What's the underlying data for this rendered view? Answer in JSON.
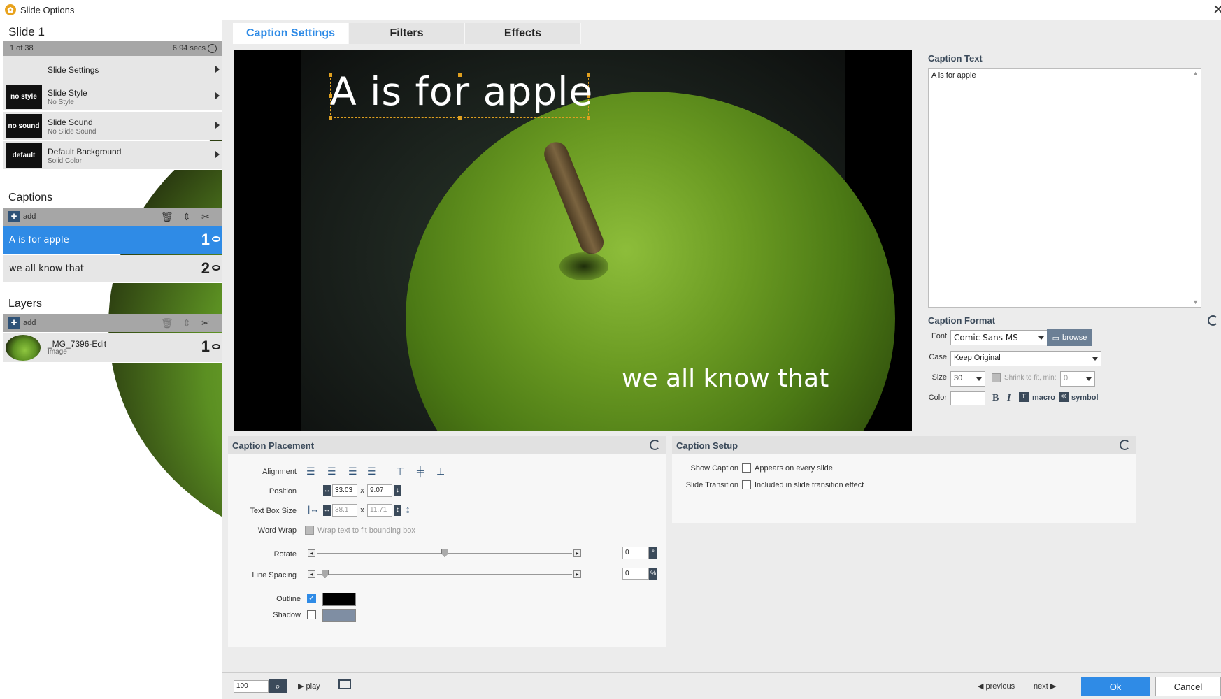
{
  "window": {
    "title": "Slide Options"
  },
  "slide": {
    "name": "Slide 1",
    "position": "1 of 38",
    "duration": "6.94 secs"
  },
  "slide_menu": [
    {
      "title": "Slide Settings",
      "subtitle": "",
      "thumb": ""
    },
    {
      "title": "Slide Style",
      "subtitle": "No Style",
      "thumb": "no style"
    },
    {
      "title": "Slide Sound",
      "subtitle": "No Slide Sound",
      "thumb": "no sound"
    },
    {
      "title": "Default Background",
      "subtitle": "Solid Color",
      "thumb": "default"
    }
  ],
  "captions": {
    "heading": "Captions",
    "add_label": "add",
    "items": [
      {
        "text": "A is for apple",
        "num": "1"
      },
      {
        "text": "we all know that",
        "num": "2"
      }
    ]
  },
  "layers": {
    "heading": "Layers",
    "add_label": "add",
    "items": [
      {
        "name": "_MG_7396-Edit",
        "type": "Image",
        "num": "1"
      }
    ]
  },
  "tabs": [
    "Caption Settings",
    "Filters",
    "Effects"
  ],
  "preview": {
    "caption1": "A is for apple",
    "caption2": "we all know that"
  },
  "caption_text": {
    "heading": "Caption Text",
    "value": "A is for apple"
  },
  "caption_format": {
    "heading": "Caption Format",
    "font_label": "Font",
    "font_value": "Comic Sans MS",
    "browse_label": "browse",
    "case_label": "Case",
    "case_value": "Keep Original",
    "size_label": "Size",
    "size_value": "30",
    "shrink_label": "Shrink to fit, min:",
    "shrink_value": "0",
    "color_label": "Color",
    "bold": "B",
    "italic": "I",
    "macro_label": "macro",
    "symbol_label": "symbol"
  },
  "placement": {
    "heading": "Caption Placement",
    "alignment_label": "Alignment",
    "position_label": "Position",
    "pos_x": "33.03",
    "pos_y": "9.07",
    "textbox_label": "Text Box Size",
    "box_w": "38.1",
    "box_h": "11.71",
    "x_sep": "x",
    "wordwrap_label": "Word Wrap",
    "wordwrap_text": "Wrap text to fit bounding box",
    "rotate_label": "Rotate",
    "rotate_value": "0",
    "rotate_unit": "°",
    "rotate_level": 0.5,
    "linespacing_label": "Line Spacing",
    "linespacing_value": "0",
    "linespacing_unit": "%",
    "linespacing_level": 0.03,
    "outline_label": "Outline",
    "outline_color": "#000000",
    "shadow_label": "Shadow",
    "shadow_color": "#7f8ea3"
  },
  "setup": {
    "heading": "Caption Setup",
    "show_label": "Show Caption",
    "show_text": "Appears on every slide",
    "transition_label": "Slide Transition",
    "transition_text": "Included in slide transition effect"
  },
  "footer": {
    "zoom": "100",
    "play_label": "play",
    "previous_label": "previous",
    "next_label": "next",
    "ok_label": "Ok",
    "cancel_label": "Cancel"
  },
  "colors": {
    "accent": "#2f8be6",
    "panel_dark": "#3b4a5a"
  }
}
